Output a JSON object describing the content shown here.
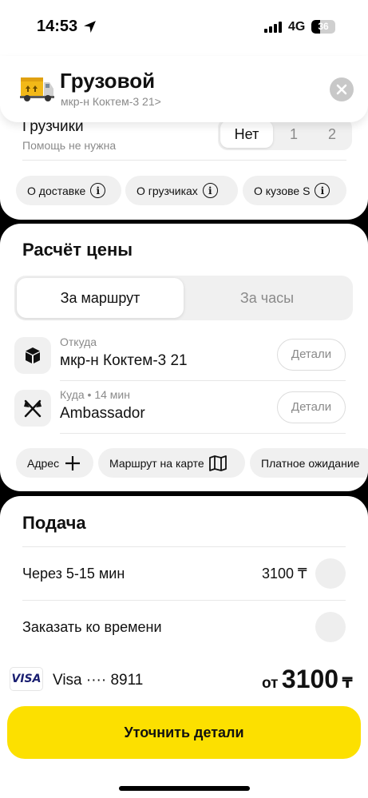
{
  "status_bar": {
    "time": "14:53",
    "network": "4G",
    "battery": "36"
  },
  "header": {
    "title": "Грузовой",
    "address": "мкр-н Коктем-3 21>"
  },
  "loaders": {
    "title": "Грузчики",
    "subtitle": "Помощь не нужна",
    "options": [
      "Нет",
      "1",
      "2"
    ],
    "selected": "Нет"
  },
  "info_chips": [
    {
      "label": "О доставке"
    },
    {
      "label": "О грузчиках"
    },
    {
      "label": "О кузове S"
    }
  ],
  "pricing": {
    "title": "Расчёт цены",
    "tabs": [
      {
        "label": "За маршрут"
      },
      {
        "label": "За часы"
      }
    ],
    "active_tab": "За маршрут"
  },
  "route": {
    "from": {
      "label": "Откуда",
      "value": "мкр-н Коктем-3 21",
      "button": "Детали"
    },
    "to": {
      "label": "Куда • 14 мин",
      "value": "Ambassador",
      "button": "Детали"
    }
  },
  "route_chips": [
    {
      "label": "Адрес"
    },
    {
      "label": "Маршрут на карте"
    },
    {
      "label": "Платное ожидание"
    }
  ],
  "pickup": {
    "title": "Подача",
    "options": [
      {
        "label": "Через 5-15 мин",
        "price": "3100 ₸"
      },
      {
        "label": "Заказать ко времени",
        "price": ""
      }
    ]
  },
  "payment": {
    "brand": "VISA",
    "card_label": "Visa ···· 8911",
    "price_prefix": "от",
    "price_amount": "3100",
    "currency": "₸"
  },
  "cta": {
    "label": "Уточнить детали"
  },
  "colors": {
    "accent": "#fce000",
    "chip_bg": "#f0f0f0",
    "muted_text": "#8a8a8a"
  }
}
